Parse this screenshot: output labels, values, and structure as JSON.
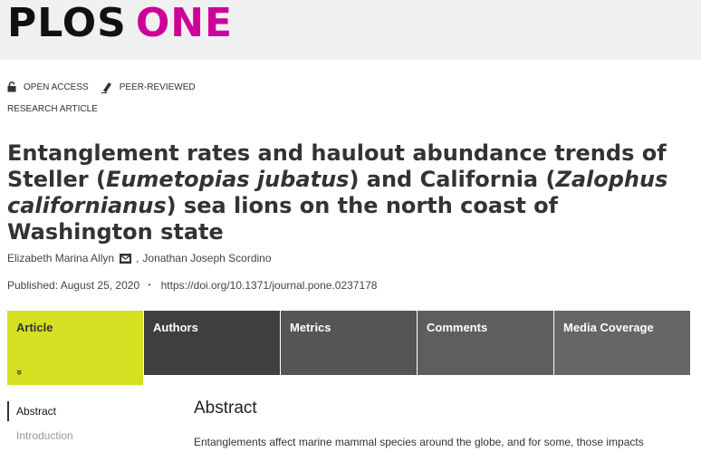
{
  "header": {
    "logo_part1": "PLOS",
    "logo_part2": "ONE",
    "brand_color": "#cc0099"
  },
  "badges": {
    "open_access": "OPEN ACCESS",
    "peer_reviewed": "PEER-REVIEWED",
    "open_access_icon": "lock-open-icon",
    "peer_reviewed_icon": "pen-icon"
  },
  "article": {
    "type": "RESEARCH ARTICLE",
    "title": {
      "part1": "Entanglement rates and haulout abundance trends of Steller (",
      "italic1": "Eumetopias jubatus",
      "part2": ") and California (",
      "italic2": "Zalophus californianus",
      "part3": ") sea lions on the north coast of Washington state"
    },
    "authors": {
      "author1": "Elizabeth Marina Allyn",
      "separator": ",",
      "author2": "Jonathan Joseph Scordino",
      "mail_icon": "envelope-icon"
    },
    "published": "Published: August 25, 2020",
    "bullet": "•",
    "doi": "https://doi.org/10.1371/journal.pone.0237178"
  },
  "tabs": [
    {
      "label": "Article",
      "active": true
    },
    {
      "label": "Authors"
    },
    {
      "label": "Metrics"
    },
    {
      "label": "Comments"
    },
    {
      "label": "Media Coverage"
    }
  ],
  "tab_chevron": "»",
  "active_tab_color": "#d4e021",
  "sidenav": [
    {
      "label": "Abstract",
      "active": true
    },
    {
      "label": "Introduction"
    }
  ],
  "content": {
    "section_title": "Abstract",
    "first_line": "Entanglements affect marine mammal species around the globe, and for some, those impacts"
  }
}
